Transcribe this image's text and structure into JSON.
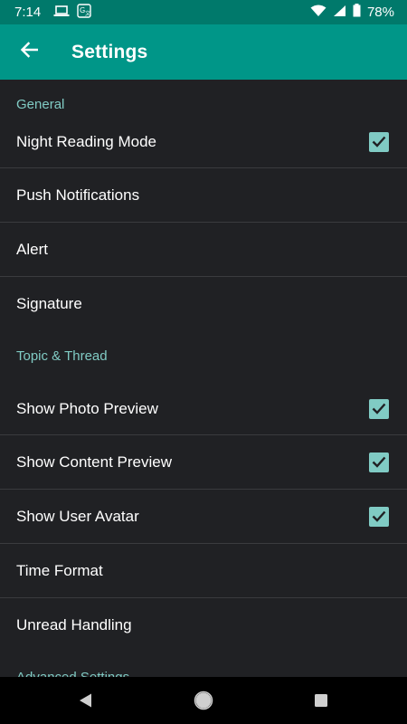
{
  "status_bar": {
    "time": "7:14",
    "battery": "78%",
    "icons": [
      "laptop-icon",
      "translate-icon",
      "wifi-icon",
      "signal-icon",
      "battery-icon"
    ]
  },
  "app_bar": {
    "title": "Settings",
    "back_icon": "arrow-back-icon"
  },
  "sections": [
    {
      "title": "General",
      "items": [
        {
          "label": "Night Reading Mode",
          "checked": true
        },
        {
          "label": "Push Notifications"
        },
        {
          "label": "Alert"
        },
        {
          "label": "Signature"
        }
      ]
    },
    {
      "title": "Topic & Thread",
      "items": [
        {
          "label": "Show Photo Preview",
          "checked": true
        },
        {
          "label": "Show Content Preview",
          "checked": true
        },
        {
          "label": "Show User Avatar",
          "checked": true
        },
        {
          "label": "Time Format"
        },
        {
          "label": "Unread Handling"
        }
      ]
    },
    {
      "title": "Advanced Settings",
      "items": []
    }
  ],
  "colors": {
    "app_bar": "#009688",
    "status_bar": "#00796b",
    "accent": "#80cbc4",
    "background": "#202124"
  },
  "nav_bar": {
    "buttons": [
      "back-triangle-icon",
      "home-circle-icon",
      "recents-square-icon"
    ]
  }
}
